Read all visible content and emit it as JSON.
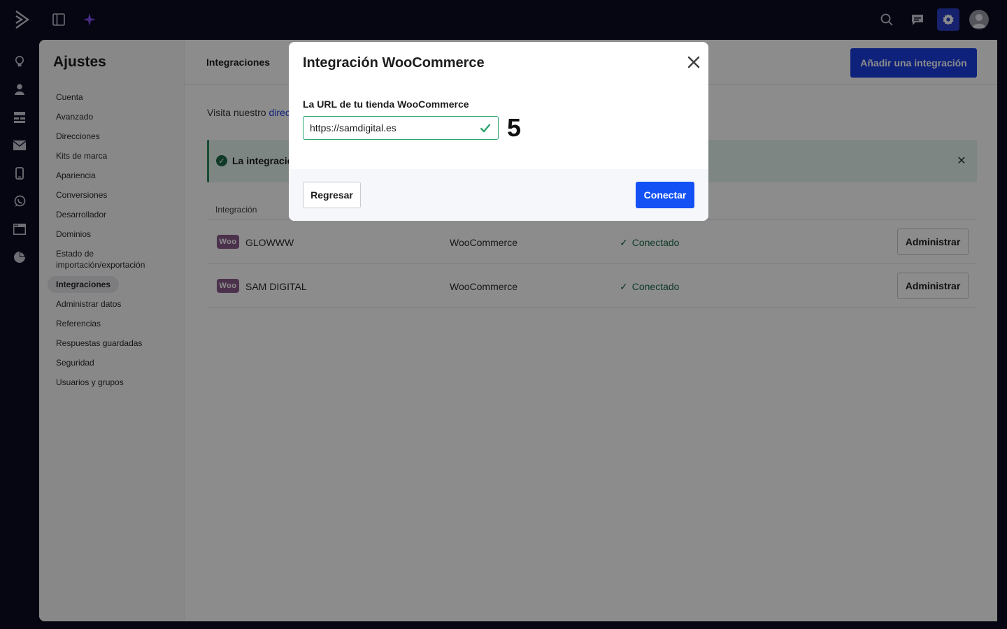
{
  "topbar": {
    "icons": [
      "logo-icon",
      "panel-toggle-icon",
      "sparkle-icon",
      "search-icon",
      "chat-icon",
      "gear-icon",
      "avatar-icon"
    ]
  },
  "rail": {
    "icons": [
      "lightbulb-icon",
      "person-icon",
      "sitemap-icon",
      "mail-icon",
      "mobile-icon",
      "whatsapp-icon",
      "window-icon",
      "pie-chart-icon"
    ]
  },
  "settings": {
    "title": "Ajustes",
    "nav": [
      {
        "label": "Cuenta"
      },
      {
        "label": "Avanzado"
      },
      {
        "label": "Direcciones"
      },
      {
        "label": "Kits de marca"
      },
      {
        "label": "Apariencia"
      },
      {
        "label": "Conversiones"
      },
      {
        "label": "Desarrollador"
      },
      {
        "label": "Dominios"
      },
      {
        "label": "Estado de importación/exportación"
      },
      {
        "label": "Integraciones",
        "active": true
      },
      {
        "label": "Administrar datos"
      },
      {
        "label": "Referencias"
      },
      {
        "label": "Respuestas guardadas"
      },
      {
        "label": "Seguridad"
      },
      {
        "label": "Usuarios y grupos"
      }
    ]
  },
  "content": {
    "title": "Integraciones",
    "add_button": "Añadir una integración",
    "intro_text": "Visita nuestro ",
    "intro_link": "direc",
    "banner_text": "La integració",
    "table_header": "Integración",
    "rows": [
      {
        "logo": "Woo",
        "name": "GLOWWW",
        "type": "WooCommerce",
        "status": "Conectado",
        "action": "Administrar"
      },
      {
        "logo": "Woo",
        "name": "SAM DIGITAL",
        "type": "WooCommerce",
        "status": "Conectado",
        "action": "Administrar"
      }
    ]
  },
  "modal": {
    "title": "Integración WooCommerce",
    "field_label": "La URL de tu tienda WooCommerce",
    "url_value": "https://samdigital.es",
    "step_number": "5",
    "back_button": "Regresar",
    "connect_button": "Conectar"
  },
  "colors": {
    "topbar_bg": "#0b0b22",
    "primary": "#1451f5",
    "success": "#1e6b49",
    "woo_purple": "#8a5a8a"
  }
}
